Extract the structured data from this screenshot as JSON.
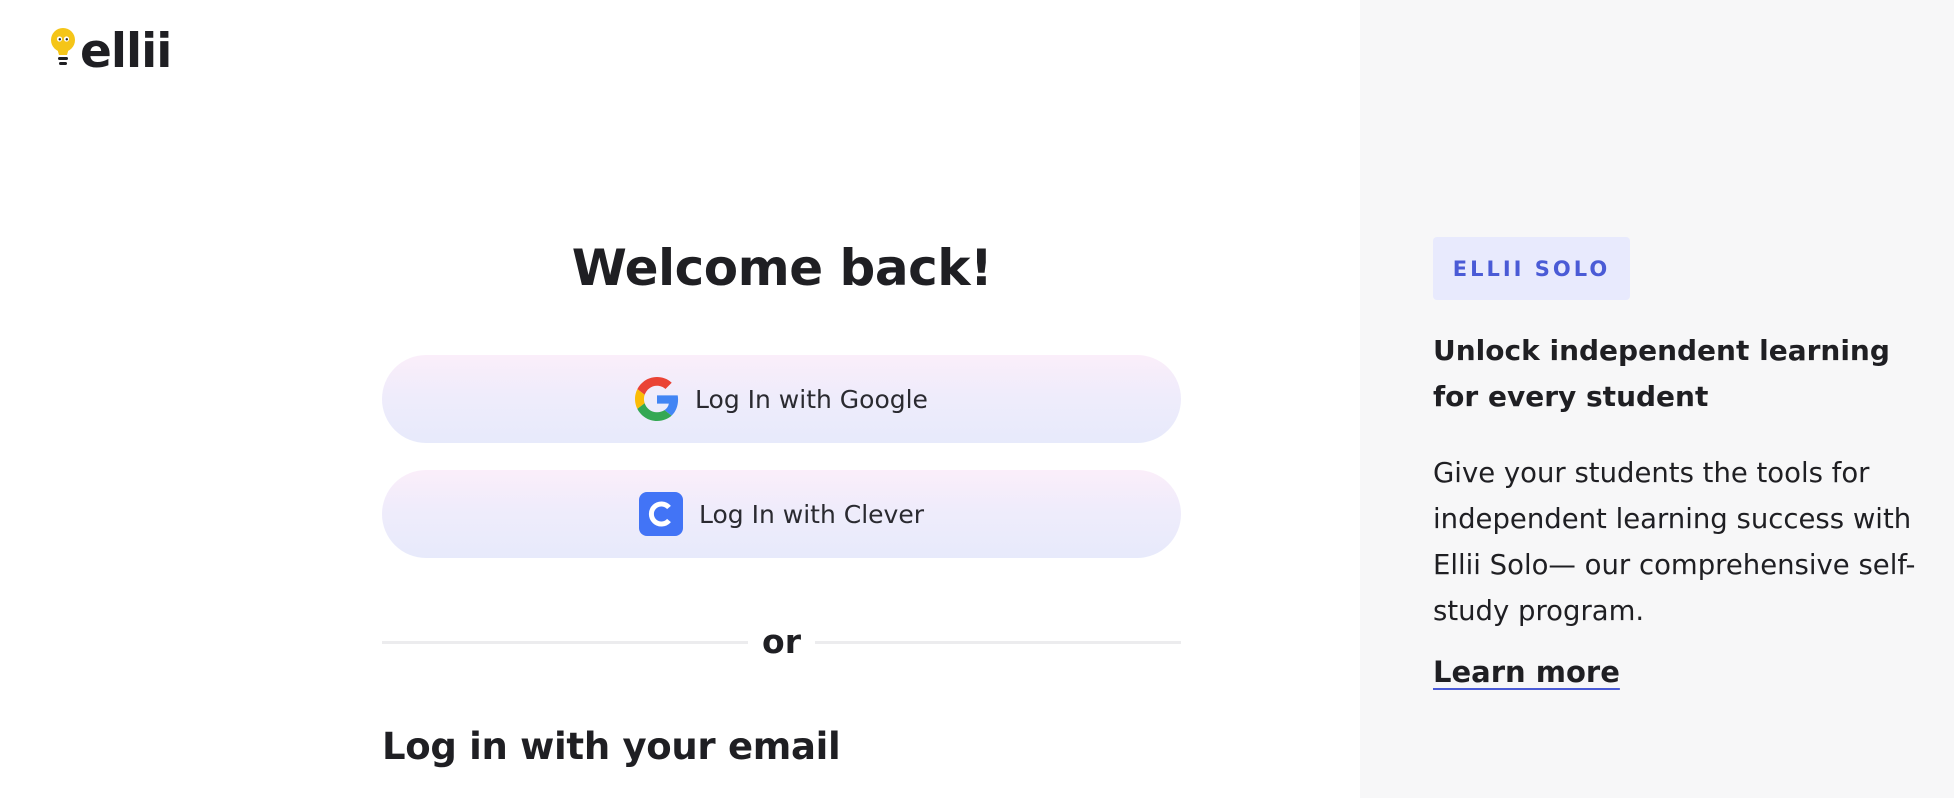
{
  "logo": {
    "text": "ellii",
    "icon": "lightbulb-icon",
    "accent_color": "#f5c518"
  },
  "main": {
    "title": "Welcome back!",
    "google_button": {
      "label": "Log In with Google",
      "icon": "google-icon"
    },
    "clever_button": {
      "label": "Log In with Clever",
      "icon": "clever-icon",
      "icon_color": "#4274f6"
    },
    "divider_text": "or",
    "email_heading": "Log in with your email"
  },
  "promo": {
    "badge": "ELLII SOLO",
    "heading": "Unlock independent learning for every student",
    "body": "Give your students the tools for independent learning success with Ellii Solo— our comprehensive self-study program.",
    "link": "Learn more",
    "accent_color": "#4a5bd6"
  }
}
